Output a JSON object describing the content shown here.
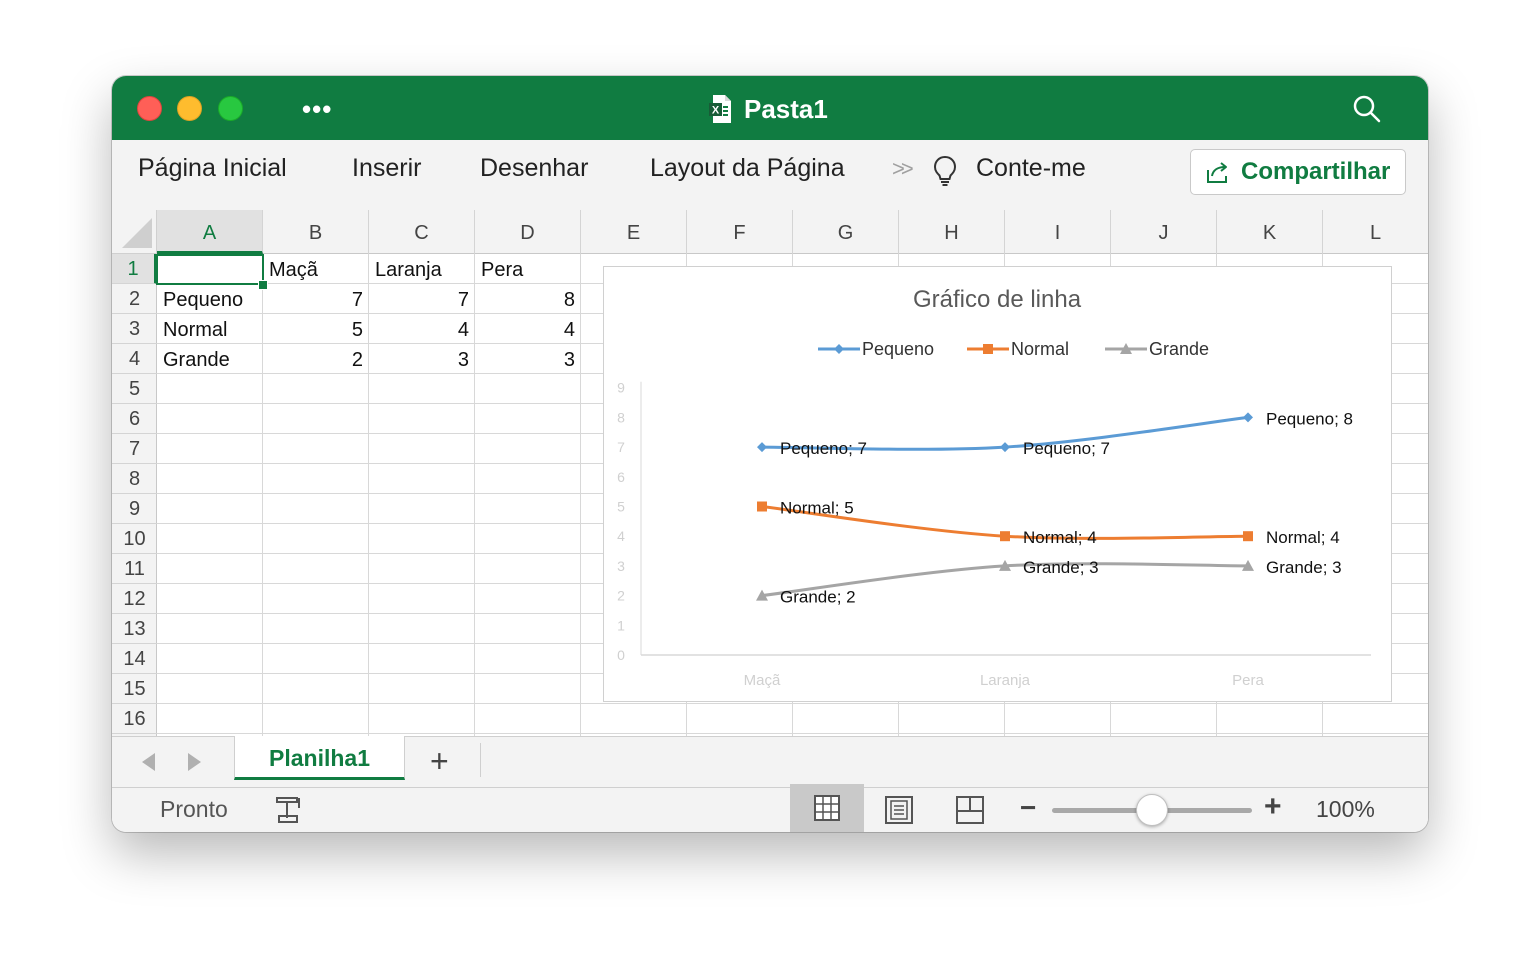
{
  "window": {
    "title": "Pasta1",
    "app_icon": "excel-icon"
  },
  "ribbon": {
    "tabs": [
      "Página Inicial",
      "Inserir",
      "Desenhar",
      "Layout da Página"
    ],
    "overflow_icon": "chevron-double-right-icon",
    "tell_me": "Conte-me",
    "share_label": "Compartilhar"
  },
  "columns": [
    "A",
    "B",
    "C",
    "D",
    "E",
    "F",
    "G",
    "H",
    "I",
    "J",
    "K",
    "L"
  ],
  "rows": [
    "1",
    "2",
    "3",
    "4",
    "5",
    "6",
    "7",
    "8",
    "9",
    "10",
    "11",
    "12",
    "13",
    "14",
    "15",
    "16"
  ],
  "selected_cell": "A1",
  "sheet": {
    "header": [
      "",
      "Maçã",
      "Laranja",
      "Pera"
    ],
    "rows": [
      {
        "label": "Pequeno",
        "values": [
          7,
          7,
          8
        ]
      },
      {
        "label": "Normal",
        "values": [
          5,
          4,
          4
        ]
      },
      {
        "label": "Grande",
        "values": [
          2,
          3,
          3
        ]
      }
    ]
  },
  "chart_data": {
    "type": "line",
    "title": "Gráfico de linha",
    "categories": [
      "Maçã",
      "Laranja",
      "Pera"
    ],
    "series": [
      {
        "name": "Pequeno",
        "values": [
          7,
          7,
          8
        ],
        "color": "#5b9bd5",
        "marker": "diamond",
        "labels": [
          "Pequeno; 7",
          "Pequeno; 7",
          "Pequeno; 8"
        ]
      },
      {
        "name": "Normal",
        "values": [
          5,
          4,
          4
        ],
        "color": "#ed7d31",
        "marker": "square",
        "labels": [
          "Normal; 5",
          "Normal; 4",
          "Normal; 4"
        ]
      },
      {
        "name": "Grande",
        "values": [
          2,
          3,
          3
        ],
        "color": "#a5a5a5",
        "marker": "triangle",
        "labels": [
          "Grande; 2",
          "Grande; 3",
          "Grande; 3"
        ]
      }
    ],
    "y_ticks": [
      "0",
      "1",
      "2",
      "3",
      "4",
      "5",
      "6",
      "7",
      "8",
      "9"
    ],
    "ylim": [
      0,
      9
    ],
    "legend": "top",
    "grid": false,
    "smooth": true
  },
  "sheet_tabs": {
    "active": "Planilha1",
    "add_label": "+"
  },
  "status": {
    "text": "Pronto",
    "zoom_minus": "−",
    "zoom_plus": "+",
    "zoom": "100%",
    "zoom_level": 1.0
  }
}
